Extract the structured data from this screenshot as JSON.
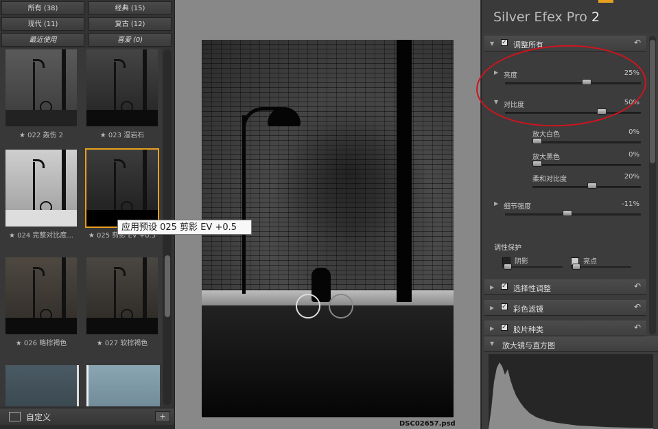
{
  "filters": [
    {
      "label": "所有 (38)"
    },
    {
      "label": "经典 (15)"
    },
    {
      "label": "现代 (11)"
    },
    {
      "label": "复古 (12)"
    },
    {
      "label": "最近使用"
    },
    {
      "label": "喜爱 (0)"
    }
  ],
  "presets": [
    {
      "caption": "★ 022 轰伤 2"
    },
    {
      "caption": "★ 023 湿岩石"
    },
    {
      "caption": "★ 024 完整对比度..."
    },
    {
      "caption": "★ 025 剪影 EV +0.5"
    },
    {
      "caption": "★ 026 略棕褐色"
    },
    {
      "caption": "★ 027 软棕褐色"
    }
  ],
  "tooltip": "应用预设 025 剪影 EV +0.5",
  "custom_bar": {
    "label": "自定义",
    "add": "+"
  },
  "filename": "DSC02657.psd",
  "app_title": {
    "name": "Silver Efex Pro",
    "version": "2"
  },
  "sections": {
    "global": "调整所有",
    "selective": "选择性调整",
    "color_filter": "彩色滤镜",
    "film_type": "胶片种类",
    "loupe": "放大镜与直方图"
  },
  "sliders": {
    "brightness": {
      "label": "亮度",
      "value": "25%",
      "fraction": 0.6
    },
    "contrast": {
      "label": "对比度",
      "value": "50%",
      "fraction": 0.72
    },
    "amplify_whites": {
      "label": "放大白色",
      "value": "0%",
      "fraction": 0.0
    },
    "amplify_blacks": {
      "label": "放大黑色",
      "value": "0%",
      "fraction": 0.0
    },
    "soft_contrast": {
      "label": "柔和对比度",
      "value": "20%",
      "fraction": 0.55
    },
    "structure": {
      "label": "细节强度",
      "value": "-11%",
      "fraction": 0.45
    }
  },
  "tonality": {
    "label": "调性保护",
    "shadows": "阴影",
    "highlights": "亮点"
  },
  "colors": {
    "accent": "#e8a020",
    "annotation": "#d0141e"
  },
  "icons": {
    "reset": "↶",
    "check": "✓",
    "expand": "▼",
    "collapse": "▶"
  }
}
